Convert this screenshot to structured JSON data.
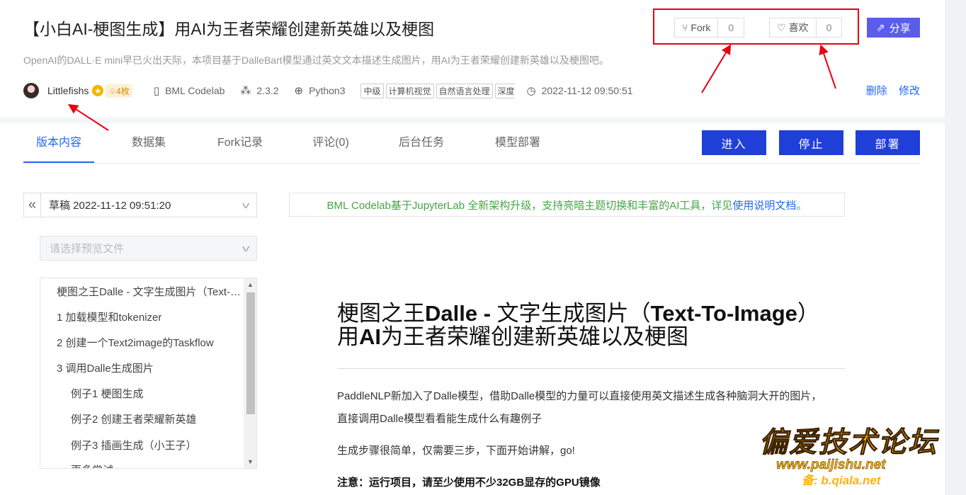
{
  "project": {
    "title": "【小白AI-梗图生成】用AI为王者荣耀创建新英雄以及梗图",
    "subtitle": "OpenAI的DALL·E mini早已火出天际，本项目基于DalleBart模型通过英文文本描述生成图片，用AI为王者荣耀创建新英雄以及梗图吧。",
    "author": "Littlefishs",
    "badge_count": "4枚",
    "environment": "BML Codelab",
    "version": "2.3.2",
    "language": "Python3",
    "tags": [
      "中级",
      "计算机视觉",
      "自然语言处理",
      "深度学习"
    ],
    "timestamp": "2022-11-12 09:50:51",
    "delete_label": "删除",
    "edit_label": "修改"
  },
  "social": {
    "fork_label": "Fork",
    "fork_count": "0",
    "like_label": "喜欢",
    "like_count": "0",
    "share_label": "分享"
  },
  "tabs": [
    "版本内容",
    "数据集",
    "Fork记录",
    "评论(0)",
    "后台任务",
    "模型部署"
  ],
  "buttons": {
    "enter": "进入",
    "stop": "停止",
    "deploy": "部署"
  },
  "sidebar": {
    "version_select": "草稿 2022-11-12 09:51:20",
    "file_placeholder": "请选择预览文件",
    "toc": [
      "梗图之王Dalle - 文字生成图片（Text-To-Image）",
      "1 加载模型和tokenizer",
      "2 创建一个Text2image的Taskflow",
      "3 调用Dalle生成图片",
      "例子1 梗图生成",
      "例子2 创建王者荣耀新英雄",
      "例子3 插画生成（小王子）",
      "更多尝试"
    ]
  },
  "notice": {
    "text": "BML Codelab基于JupyterLab 全新架构升级，支持亮暗主题切换和丰富的AI工具，详见",
    "link": "使用说明文档",
    "end": "。"
  },
  "doc": {
    "h1_line1_a": "梗图之王",
    "h1_line1_b": "Dalle - ",
    "h1_line1_c": "文字生成图片（",
    "h1_line1_d": "Text-To-Image",
    "h1_line1_e": "）",
    "h1_line2_a": "用",
    "h1_line2_b": "AI",
    "h1_line2_c": "为王者荣耀创建新英雄以及梗图",
    "p1": "PaddleNLP新加入了Dalle模型，借助Dalle模型的力量可以直接使用英文描述生成各种脑洞大开的图片，",
    "p2": "直接调用Dalle模型看看能生成什么有趣例子",
    "p3": "生成步骤很简单，仅需要三步，下面开始讲解，go!",
    "p4": "注意：运行项目，请至少使用不少32GB显存的GPU镜像"
  },
  "watermark": {
    "line1": "偏爱技术论坛",
    "line2": "www.paijishu.net",
    "line3": "备: b.qiala.net"
  },
  "colors": {
    "accent_blue": "#2468f2",
    "button_dark": "#1f3fd8",
    "share_purple": "#5a5cea",
    "annotation_red": "#e60012",
    "notice_green": "#47a447"
  }
}
